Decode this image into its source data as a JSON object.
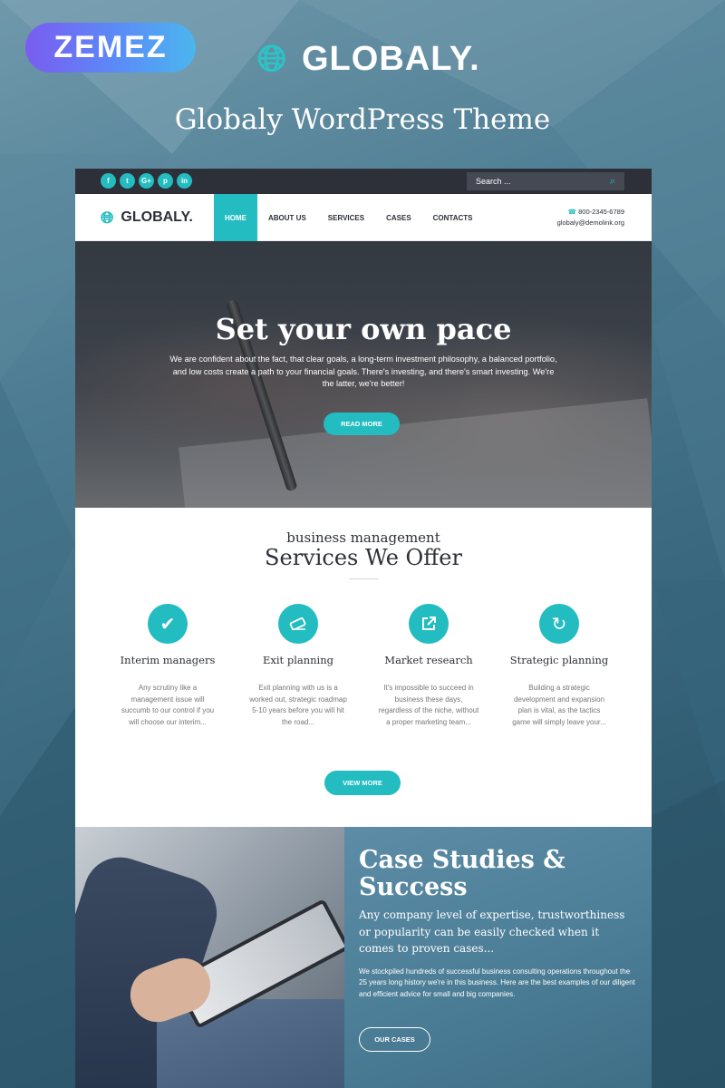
{
  "promo": {
    "badge_text": "ZEMEZ",
    "brand_name": "GLOBALY.",
    "headline": "Globaly WordPress Theme"
  },
  "topbar": {
    "socials": [
      {
        "label": "f",
        "icon": "facebook-icon"
      },
      {
        "label": "t",
        "icon": "twitter-icon"
      },
      {
        "label": "G+",
        "icon": "google-plus-icon"
      },
      {
        "label": "p",
        "icon": "pinterest-icon"
      },
      {
        "label": "in",
        "icon": "linkedin-icon"
      }
    ],
    "search_placeholder": "Search ..."
  },
  "nav": {
    "logo_text": "GLOBALY.",
    "items": [
      "HOME",
      "ABOUT US",
      "SERVICES",
      "CASES",
      "CONTACTS"
    ],
    "active_item": "HOME",
    "phone": "800-2345-6789",
    "email": "globaly@demolink.org"
  },
  "hero": {
    "title": "Set your own pace",
    "text": "We are confident about the fact, that clear goals, a long-term investment philosophy, a balanced portfolio, and low costs create a path to your financial goals. There's investing, and there's smart investing. We're the latter, we're better!",
    "button": "READ MORE"
  },
  "services": {
    "subtitle": "business management",
    "title": "Services We Offer",
    "items": [
      {
        "name": "Interim managers",
        "icon": "checkmark-icon",
        "desc": "Any scrutiny like a management issue will succumb to our control if you will choose our interim..."
      },
      {
        "name": "Exit planning",
        "icon": "eraser-icon",
        "desc": "Exit planning with us is a worked out, strategic roadmap 5-10 years before you will hit the road..."
      },
      {
        "name": "Market research",
        "icon": "external-link-icon",
        "desc": "It's impossible to succeed in business these days, regardless of the niche, without a proper marketing team..."
      },
      {
        "name": "Strategic planning",
        "icon": "refresh-icon",
        "desc": "Building a strategic development and expansion plan is vital, as the tactics game will simply leave your..."
      }
    ],
    "button": "VIEW MORE"
  },
  "cases": {
    "title": "Case Studies & Success",
    "lead": "Any company level of expertise, trustworthiness or popularity can be easily checked when it comes to proven cases...",
    "text": "We stockpiled hundreds of successful business consulting operations throughout the 25 years long history we're in this business. Here are the best examples of our diligent and efficient advice for small and big companies.",
    "button": "OUR CASES"
  },
  "colors": {
    "accent": "#23bcc1",
    "topbar": "#2d3038",
    "text_dark": "#2d3038"
  }
}
